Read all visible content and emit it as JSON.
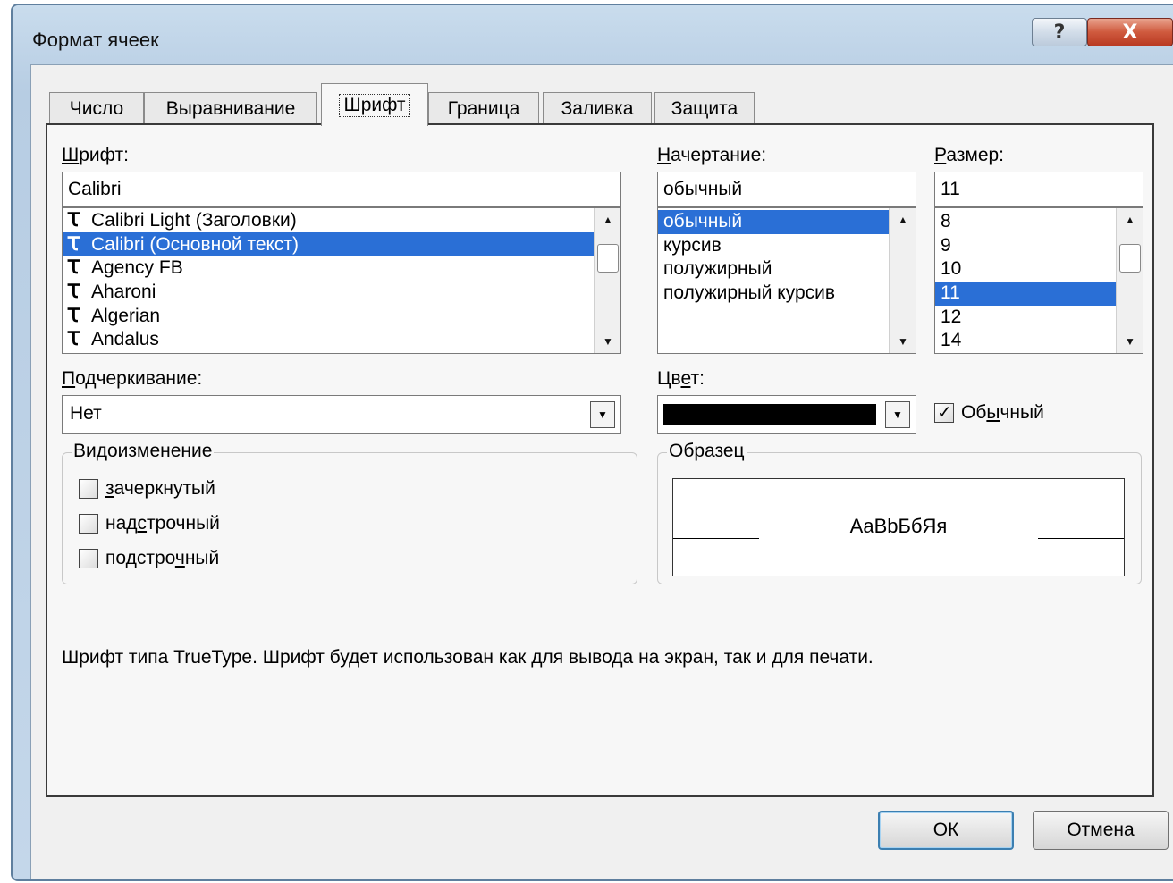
{
  "window": {
    "title": "Формат ячеек",
    "help_glyph": "?",
    "close_glyph": "X"
  },
  "tabs": [
    {
      "label": "Число"
    },
    {
      "label": "Выравнивание"
    },
    {
      "label": "Шрифт",
      "active": true
    },
    {
      "label": "Граница"
    },
    {
      "label": "Заливка"
    },
    {
      "label": "Защита"
    }
  ],
  "font": {
    "label_u": "Ш",
    "label_rest": "рифт:",
    "value": "Calibri",
    "items": [
      "Calibri Light (Заголовки)",
      "Calibri (Основной текст)",
      "Agency FB",
      "Aharoni",
      "Algerian",
      "Andalus"
    ],
    "selected_index": 1,
    "icon_glyph": "Ꚍ"
  },
  "style": {
    "label_u": "Н",
    "label_rest": "ачертание:",
    "value": "обычный",
    "items": [
      "обычный",
      "курсив",
      "полужирный",
      "полужирный курсив"
    ],
    "selected_index": 0
  },
  "size": {
    "label_u": "Р",
    "label_rest": "азмер:",
    "value": "11",
    "items": [
      "8",
      "9",
      "10",
      "11",
      "12",
      "14"
    ],
    "selected_index": 3
  },
  "underline": {
    "label_u": "П",
    "label_rest": "одчеркивание:",
    "value": "Нет"
  },
  "color": {
    "label_a": "Цв",
    "label_u": "е",
    "label_b": "т:",
    "swatch": "#000000",
    "normal_a": "Об",
    "normal_u": "ы",
    "normal_b": "чный",
    "normal_checked": true
  },
  "effects": {
    "title": "Видоизменение",
    "items": [
      {
        "a": "",
        "u": "з",
        "b": "ачеркнутый",
        "checked": false
      },
      {
        "a": "над",
        "u": "с",
        "b": "трочный",
        "checked": false
      },
      {
        "a": "подстро",
        "u": "ч",
        "b": "ный",
        "checked": false
      }
    ]
  },
  "preview": {
    "title": "Образец",
    "sample": "AaBbБбЯя"
  },
  "description": "Шрифт типа TrueType. Шрифт будет использован как для вывода на экран, так и для печати.",
  "buttons": {
    "ok": "ОК",
    "cancel": "Отмена"
  }
}
